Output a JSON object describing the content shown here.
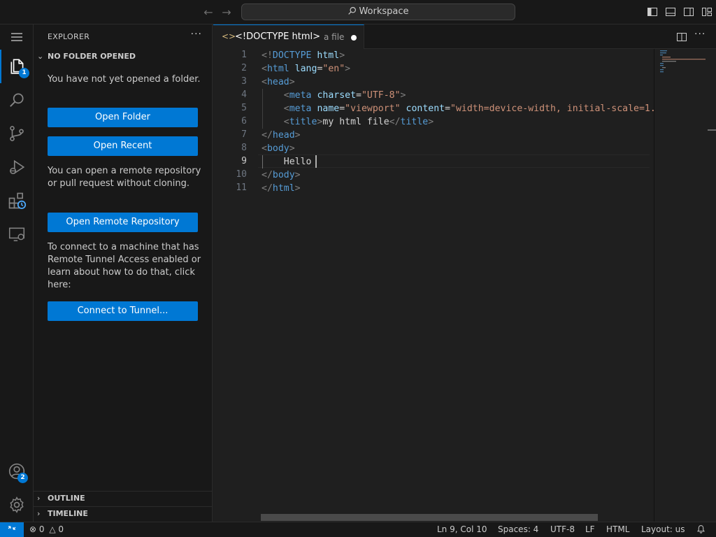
{
  "titlebar": {
    "search_label": "Workspace",
    "back_icon": "arrow-left-icon",
    "forward_icon": "arrow-right-icon"
  },
  "activity_bar": {
    "explorer_badge": "1",
    "accounts_badge": "2"
  },
  "sidebar": {
    "title": "EXPLORER",
    "more": "···",
    "section_title": "NO FOLDER OPENED",
    "no_folder_text": "You have not yet opened a folder.",
    "open_folder": "Open Folder",
    "open_recent": "Open Recent",
    "remote_text": "You can open a remote repository or pull request without cloning.",
    "open_remote": "Open Remote Repository",
    "tunnel_text": "To connect to a machine that has Remote Tunnel Access enabled or learn about how to do that, click here:",
    "connect_tunnel": "Connect to Tunnel...",
    "outline": "OUTLINE",
    "timeline": "TIMELINE"
  },
  "editor": {
    "tab_icon": "<>",
    "tab_label": "<!DOCTYPE html>",
    "tab_description": "a file",
    "line_numbers": [
      "1",
      "2",
      "3",
      "4",
      "5",
      "6",
      "7",
      "8",
      "9",
      "10",
      "11"
    ],
    "current_line": "9"
  },
  "statusbar": {
    "errors": "0",
    "warnings": "0",
    "cursor_position": "Ln 9, Col 10",
    "spaces": "Spaces: 4",
    "encoding": "UTF-8",
    "eol": "LF",
    "language": "HTML",
    "layout": "Layout: us"
  },
  "colors": {
    "accent": "#0078d4",
    "background": "#1f1f1f",
    "sidebar": "#181818"
  }
}
